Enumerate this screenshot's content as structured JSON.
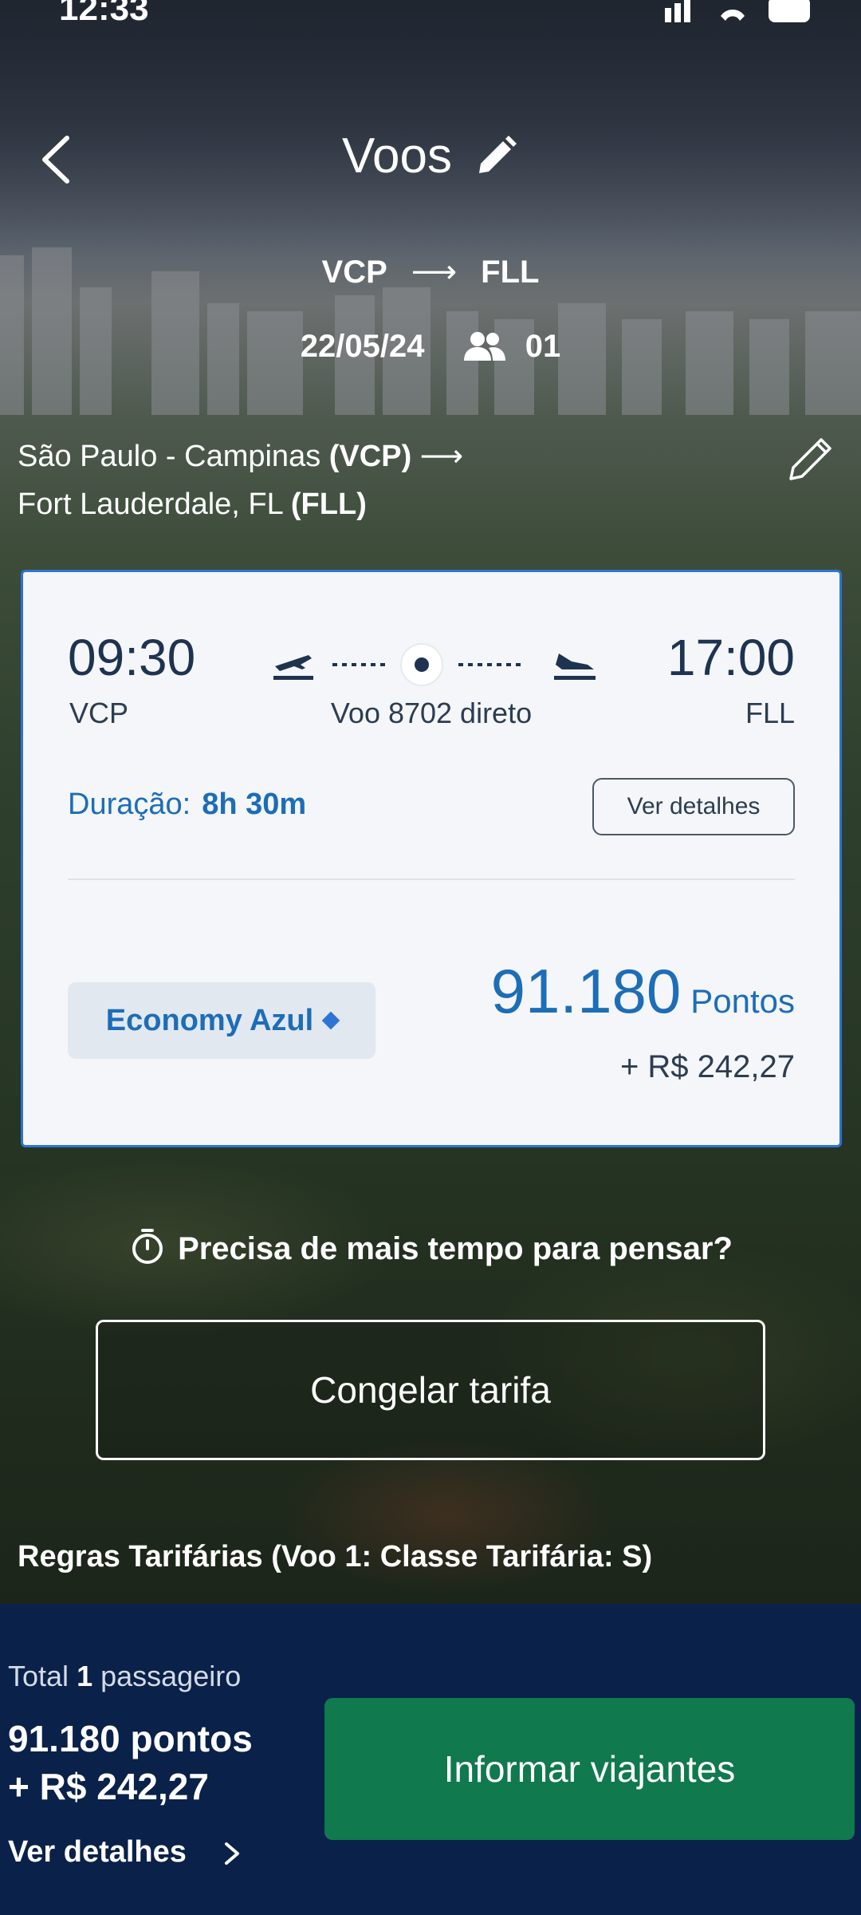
{
  "status_bar": {
    "time": "12:33"
  },
  "header": {
    "title": "Voos"
  },
  "search": {
    "origin_code": "VCP",
    "destination_code": "FLL",
    "date": "22/05/24",
    "passengers": "01"
  },
  "route_text": {
    "origin_city": "São Paulo - Campinas",
    "origin_code_paren": "(VCP)",
    "destination_city": "Fort Lauderdale, FL",
    "destination_code_paren": "(FLL)"
  },
  "flight": {
    "departure_time": "09:30",
    "arrival_time": "17:00",
    "departure_code": "VCP",
    "arrival_code": "FLL",
    "flight_info": "Voo 8702 direto",
    "duration_label": "Duração:",
    "duration_value": "8h 30m",
    "details_button": "Ver detalhes",
    "cabin": "Economy Azul",
    "points": "91.180",
    "points_label": "Pontos",
    "fee": "+ R$ 242,27"
  },
  "think": {
    "text": "Precisa de mais tempo para pensar?"
  },
  "freeze_button": "Congelar tarifa",
  "fare_rules": "Regras Tarifárias (Voo 1: Classe Tarifária: S)",
  "footer": {
    "total_prefix": "Total",
    "total_count": "1",
    "total_suffix": "passageiro",
    "total_points": "91.180 pontos",
    "total_fee": "+ R$ 242,27",
    "details_link": "Ver detalhes",
    "cta": "Informar viajantes"
  },
  "colors": {
    "accent_blue": "#1d6db7",
    "card_border": "#2e74d2",
    "footer_bg": "#0a214a",
    "cta_green": "#10794e"
  }
}
